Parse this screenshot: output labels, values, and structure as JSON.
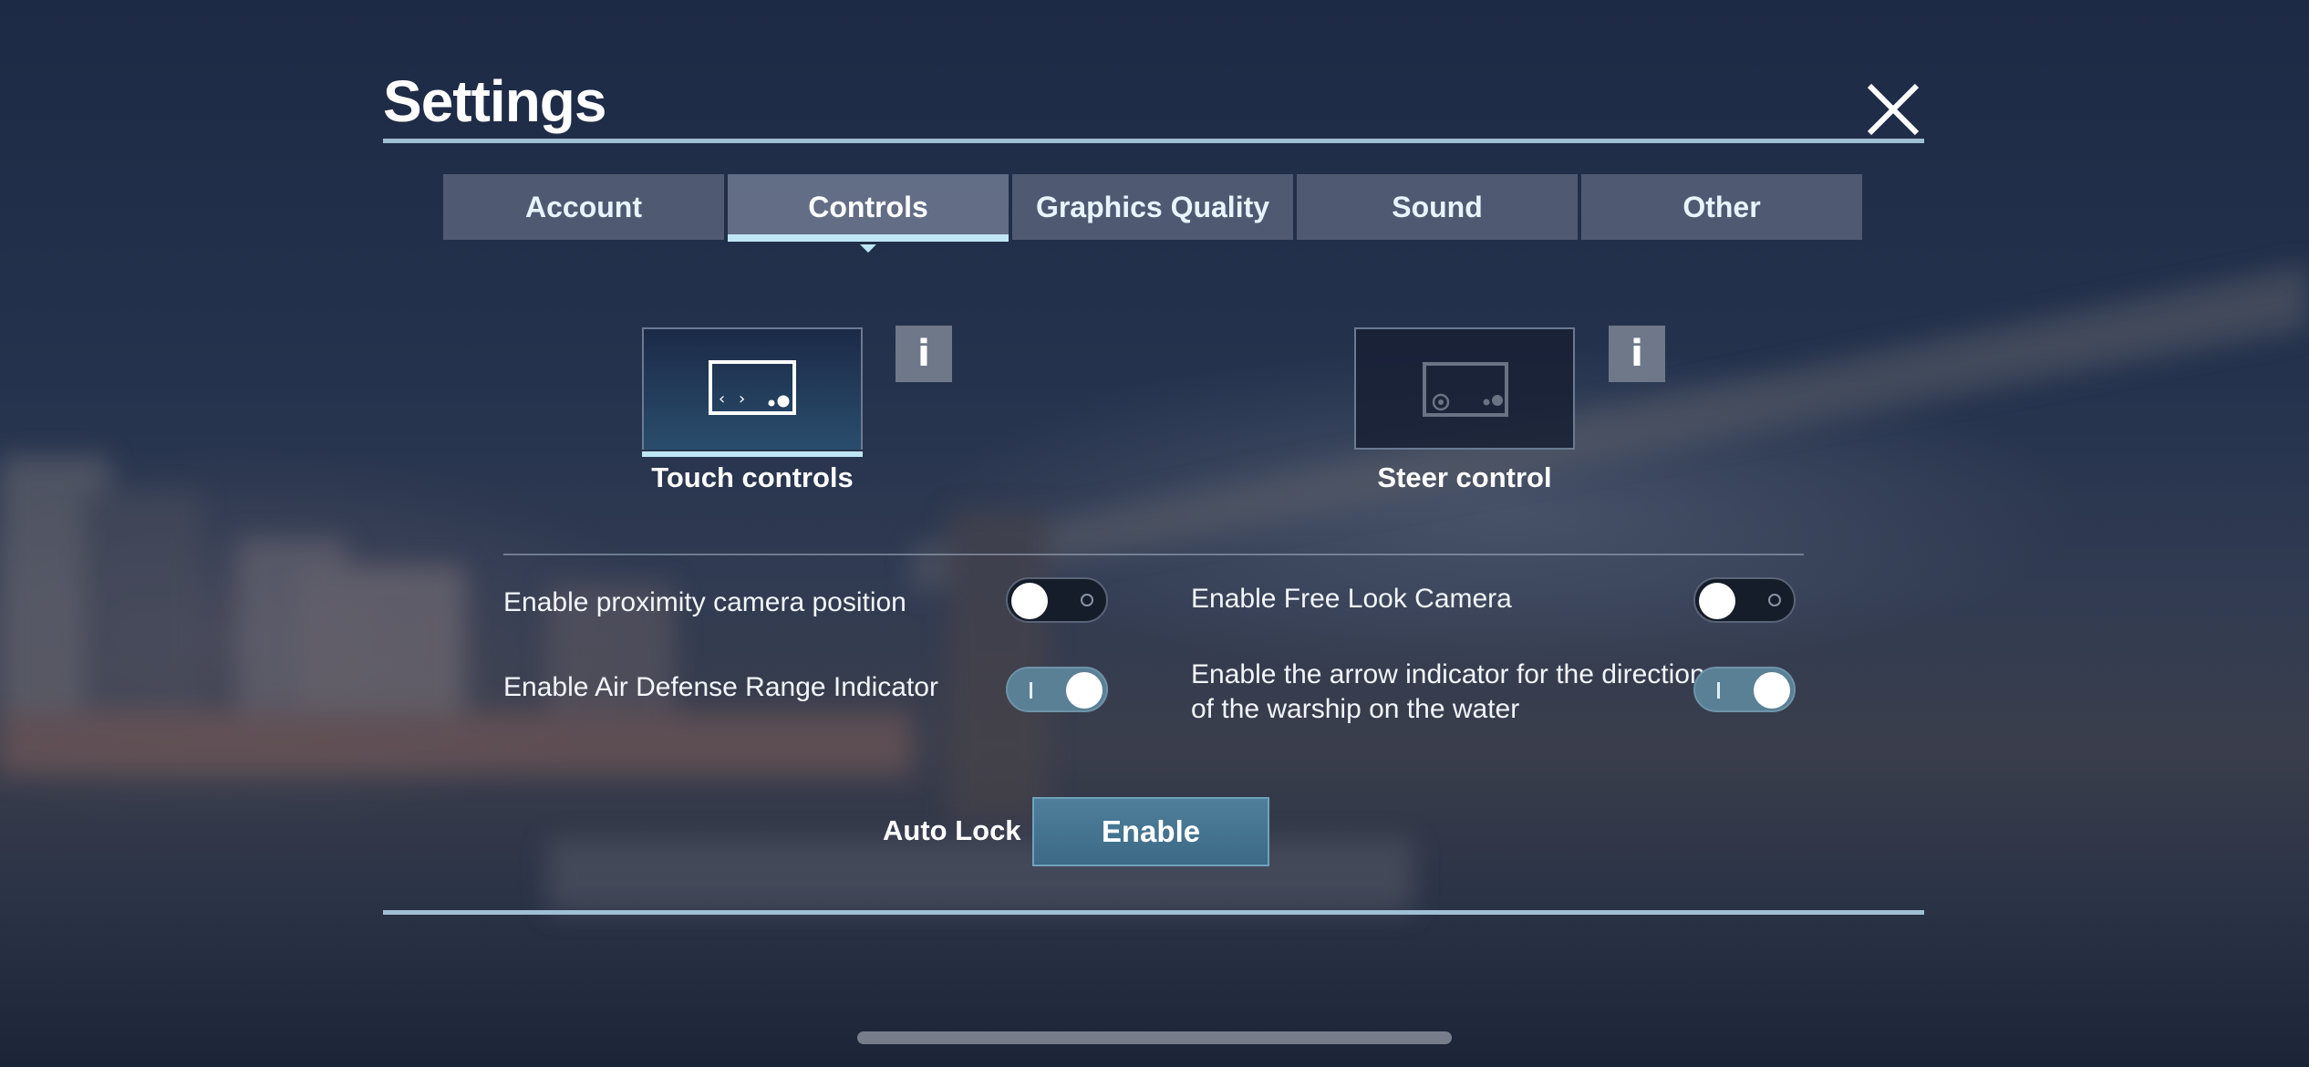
{
  "header": {
    "title": "Settings"
  },
  "tabs": [
    {
      "label": "Account",
      "active": false
    },
    {
      "label": "Controls",
      "active": true
    },
    {
      "label": "Graphics Quality",
      "active": false
    },
    {
      "label": "Sound",
      "active": false
    },
    {
      "label": "Other",
      "active": false
    }
  ],
  "control_modes": {
    "touch": {
      "label": "Touch controls",
      "selected": true,
      "info": "i"
    },
    "steer": {
      "label": "Steer control",
      "selected": false,
      "info": "i"
    }
  },
  "options": {
    "proximity_camera": {
      "label": "Enable proximity camera position",
      "enabled": false
    },
    "free_look_camera": {
      "label": "Enable Free Look Camera",
      "enabled": false
    },
    "air_defense_indicator": {
      "label": "Enable Air Defense Range Indicator",
      "enabled": true
    },
    "arrow_indicator": {
      "label_line1": "Enable the arrow indicator for the direction",
      "label_line2": "of the warship on the water",
      "enabled": true
    }
  },
  "auto_lock": {
    "label": "Auto Lock",
    "button_label": "Enable"
  },
  "colors": {
    "accent": "#bfe6f4",
    "toggle_on": "#5a8096",
    "toggle_off": "#161d2a",
    "tab_bg": "#5f6980"
  }
}
